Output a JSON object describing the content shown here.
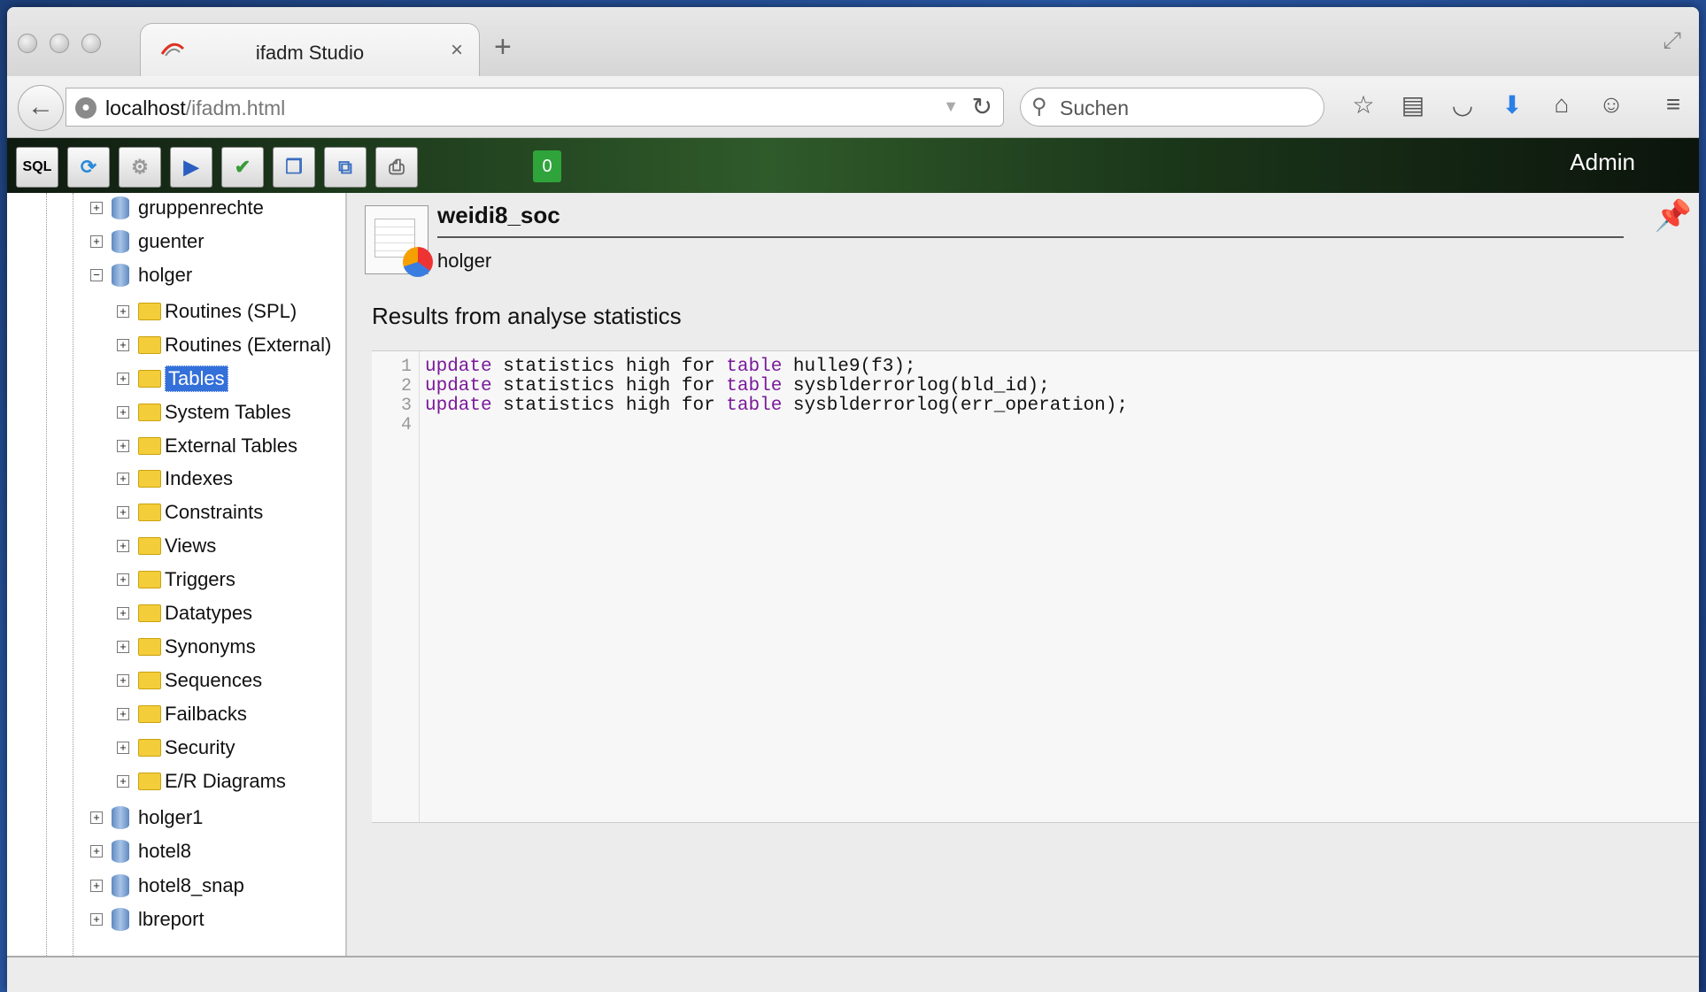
{
  "browser": {
    "tab_title": "ifadm Studio",
    "tab_close": "×",
    "new_tab": "+",
    "url_host": "localhost",
    "url_path": "/ifadm.html",
    "search_placeholder": "Suchen"
  },
  "toolbar": {
    "sql_label": "SQL",
    "counter": "0",
    "user": "Admin"
  },
  "tree": {
    "items": [
      {
        "label": "gruppenrechte",
        "kind": "database",
        "expander": "+"
      },
      {
        "label": "guenter",
        "kind": "database",
        "expander": "+"
      },
      {
        "label": "holger",
        "kind": "database",
        "expander": "−"
      },
      {
        "label": "Routines (SPL)",
        "kind": "folder",
        "expander": "+"
      },
      {
        "label": "Routines (External)",
        "kind": "folder",
        "expander": "+"
      },
      {
        "label": "Tables",
        "kind": "folder",
        "expander": "+",
        "selected": true
      },
      {
        "label": "System Tables",
        "kind": "folder",
        "expander": "+"
      },
      {
        "label": "External Tables",
        "kind": "folder",
        "expander": "+"
      },
      {
        "label": "Indexes",
        "kind": "folder",
        "expander": "+"
      },
      {
        "label": "Constraints",
        "kind": "folder",
        "expander": "+"
      },
      {
        "label": "Views",
        "kind": "folder",
        "expander": "+"
      },
      {
        "label": "Triggers",
        "kind": "folder",
        "expander": "+"
      },
      {
        "label": "Datatypes",
        "kind": "folder",
        "expander": "+"
      },
      {
        "label": "Synonyms",
        "kind": "folder",
        "expander": "+"
      },
      {
        "label": "Sequences",
        "kind": "folder",
        "expander": "+"
      },
      {
        "label": "Failbacks",
        "kind": "folder",
        "expander": "+"
      },
      {
        "label": "Security",
        "kind": "folder",
        "expander": "+"
      },
      {
        "label": "E/R Diagrams",
        "kind": "folder",
        "expander": "+"
      },
      {
        "label": "holger1",
        "kind": "database",
        "expander": "+"
      },
      {
        "label": "hotel8",
        "kind": "database",
        "expander": "+"
      },
      {
        "label": "hotel8_snap",
        "kind": "database",
        "expander": "+"
      },
      {
        "label": "lbreport",
        "kind": "database",
        "expander": "+"
      }
    ]
  },
  "main": {
    "object_name": "weidi8_soc",
    "owner": "holger",
    "section_title": "Results from analyse statistics",
    "code": {
      "line_numbers": [
        "1",
        "2",
        "3",
        "4"
      ],
      "keyword_update": "update",
      "keyword_table": "table",
      "lines": [
        {
          "pre": " statistics high for ",
          "post": " hulle9(f3);"
        },
        {
          "pre": " statistics high for ",
          "post": " sysblderrorlog(bld_id);"
        },
        {
          "pre": " statistics high for ",
          "post": " sysblderrorlog(err_operation);"
        }
      ]
    }
  },
  "colors": {
    "keyword": "#7a1a9a",
    "selection": "#3470d9",
    "counter_badge": "#2fa43b"
  }
}
